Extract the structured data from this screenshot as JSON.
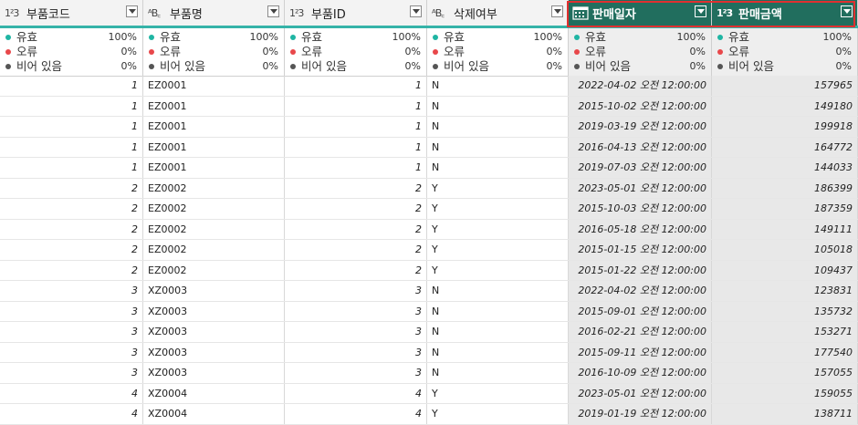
{
  "columns": [
    {
      "type": "1²3",
      "name": "부품코드"
    },
    {
      "type": "ᴬB꜀",
      "name": "부품명"
    },
    {
      "type": "1²3",
      "name": "부품ID"
    },
    {
      "type": "ᴬB꜀",
      "name": "삭제여부"
    },
    {
      "type": "calendar",
      "name": "판매일자"
    },
    {
      "type": "1²3",
      "name": "판매금액"
    }
  ],
  "stats_labels": {
    "valid": "유효",
    "error": "오류",
    "empty": "비어 있음"
  },
  "stats_values": {
    "valid": "100%",
    "error": "0%",
    "empty": "0%"
  },
  "colors": {
    "selected_header": "#216e5e",
    "teal_bar": "#35b3a8",
    "valid_dot": "#1fb5a3",
    "error_dot": "#e8474a",
    "empty_dot": "#555555",
    "highlight_border": "#e03030"
  },
  "rows": [
    [
      "1",
      "EZ0001",
      "1",
      "N",
      "2022-04-02 오전 12:00:00",
      "157965"
    ],
    [
      "1",
      "EZ0001",
      "1",
      "N",
      "2015-10-02 오전 12:00:00",
      "149180"
    ],
    [
      "1",
      "EZ0001",
      "1",
      "N",
      "2019-03-19 오전 12:00:00",
      "199918"
    ],
    [
      "1",
      "EZ0001",
      "1",
      "N",
      "2016-04-13 오전 12:00:00",
      "164772"
    ],
    [
      "1",
      "EZ0001",
      "1",
      "N",
      "2019-07-03 오전 12:00:00",
      "144033"
    ],
    [
      "2",
      "EZ0002",
      "2",
      "Y",
      "2023-05-01 오전 12:00:00",
      "186399"
    ],
    [
      "2",
      "EZ0002",
      "2",
      "Y",
      "2015-10-03 오전 12:00:00",
      "187359"
    ],
    [
      "2",
      "EZ0002",
      "2",
      "Y",
      "2016-05-18 오전 12:00:00",
      "149111"
    ],
    [
      "2",
      "EZ0002",
      "2",
      "Y",
      "2015-01-15 오전 12:00:00",
      "105018"
    ],
    [
      "2",
      "EZ0002",
      "2",
      "Y",
      "2015-01-22 오전 12:00:00",
      "109437"
    ],
    [
      "3",
      "XZ0003",
      "3",
      "N",
      "2022-04-02 오전 12:00:00",
      "123831"
    ],
    [
      "3",
      "XZ0003",
      "3",
      "N",
      "2015-09-01 오전 12:00:00",
      "135732"
    ],
    [
      "3",
      "XZ0003",
      "3",
      "N",
      "2016-02-21 오전 12:00:00",
      "153271"
    ],
    [
      "3",
      "XZ0003",
      "3",
      "N",
      "2015-09-11 오전 12:00:00",
      "177540"
    ],
    [
      "3",
      "XZ0003",
      "3",
      "N",
      "2016-10-09 오전 12:00:00",
      "157055"
    ],
    [
      "4",
      "XZ0004",
      "4",
      "Y",
      "2023-05-01 오전 12:00:00",
      "159055"
    ],
    [
      "4",
      "XZ0004",
      "4",
      "Y",
      "2019-01-19 오전 12:00:00",
      "138711"
    ]
  ]
}
